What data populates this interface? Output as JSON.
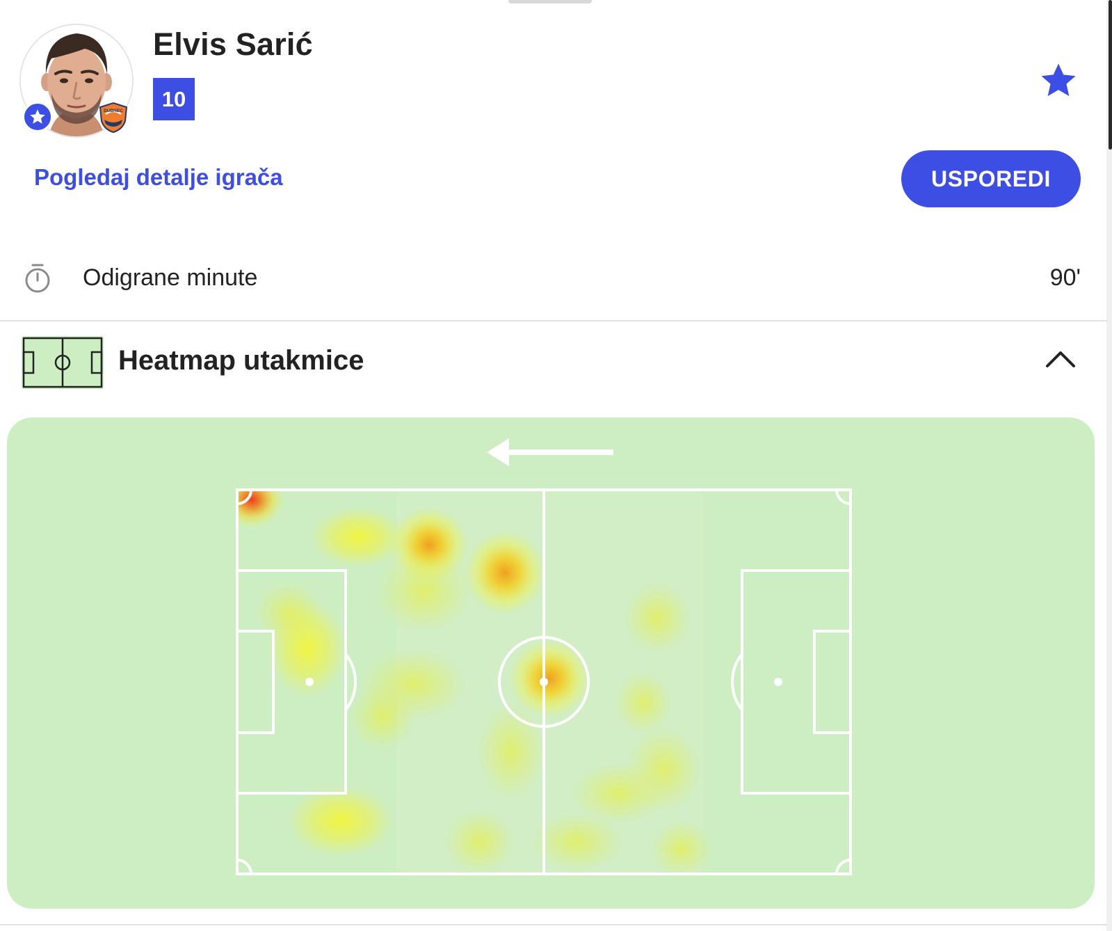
{
  "player": {
    "name": "Elvis Sarić",
    "shirt_number": "10",
    "details_link": "Pogledaj detalje igrača",
    "compare_label": "USPOREDI",
    "club_badge_text": "DUBNEC",
    "avatar_icon": "player-photo",
    "favourite_icon": "star-icon"
  },
  "stats": {
    "minutes_label": "Odigrane minute",
    "minutes_value": "90'",
    "minutes_icon": "stopwatch-icon"
  },
  "heatmap": {
    "title": "Heatmap utakmice",
    "section_icon": "pitch-icon",
    "collapse_icon": "chevron-up-icon",
    "attack_direction": "left",
    "pitch_color": "#cdeec3",
    "line_color": "#ffffff",
    "hotspot_colors": [
      "#f2f542",
      "#f0b429",
      "#ee5a24"
    ]
  },
  "colors": {
    "accent": "#3c4ee4",
    "text": "#222222",
    "divider": "#e2e2e2"
  }
}
